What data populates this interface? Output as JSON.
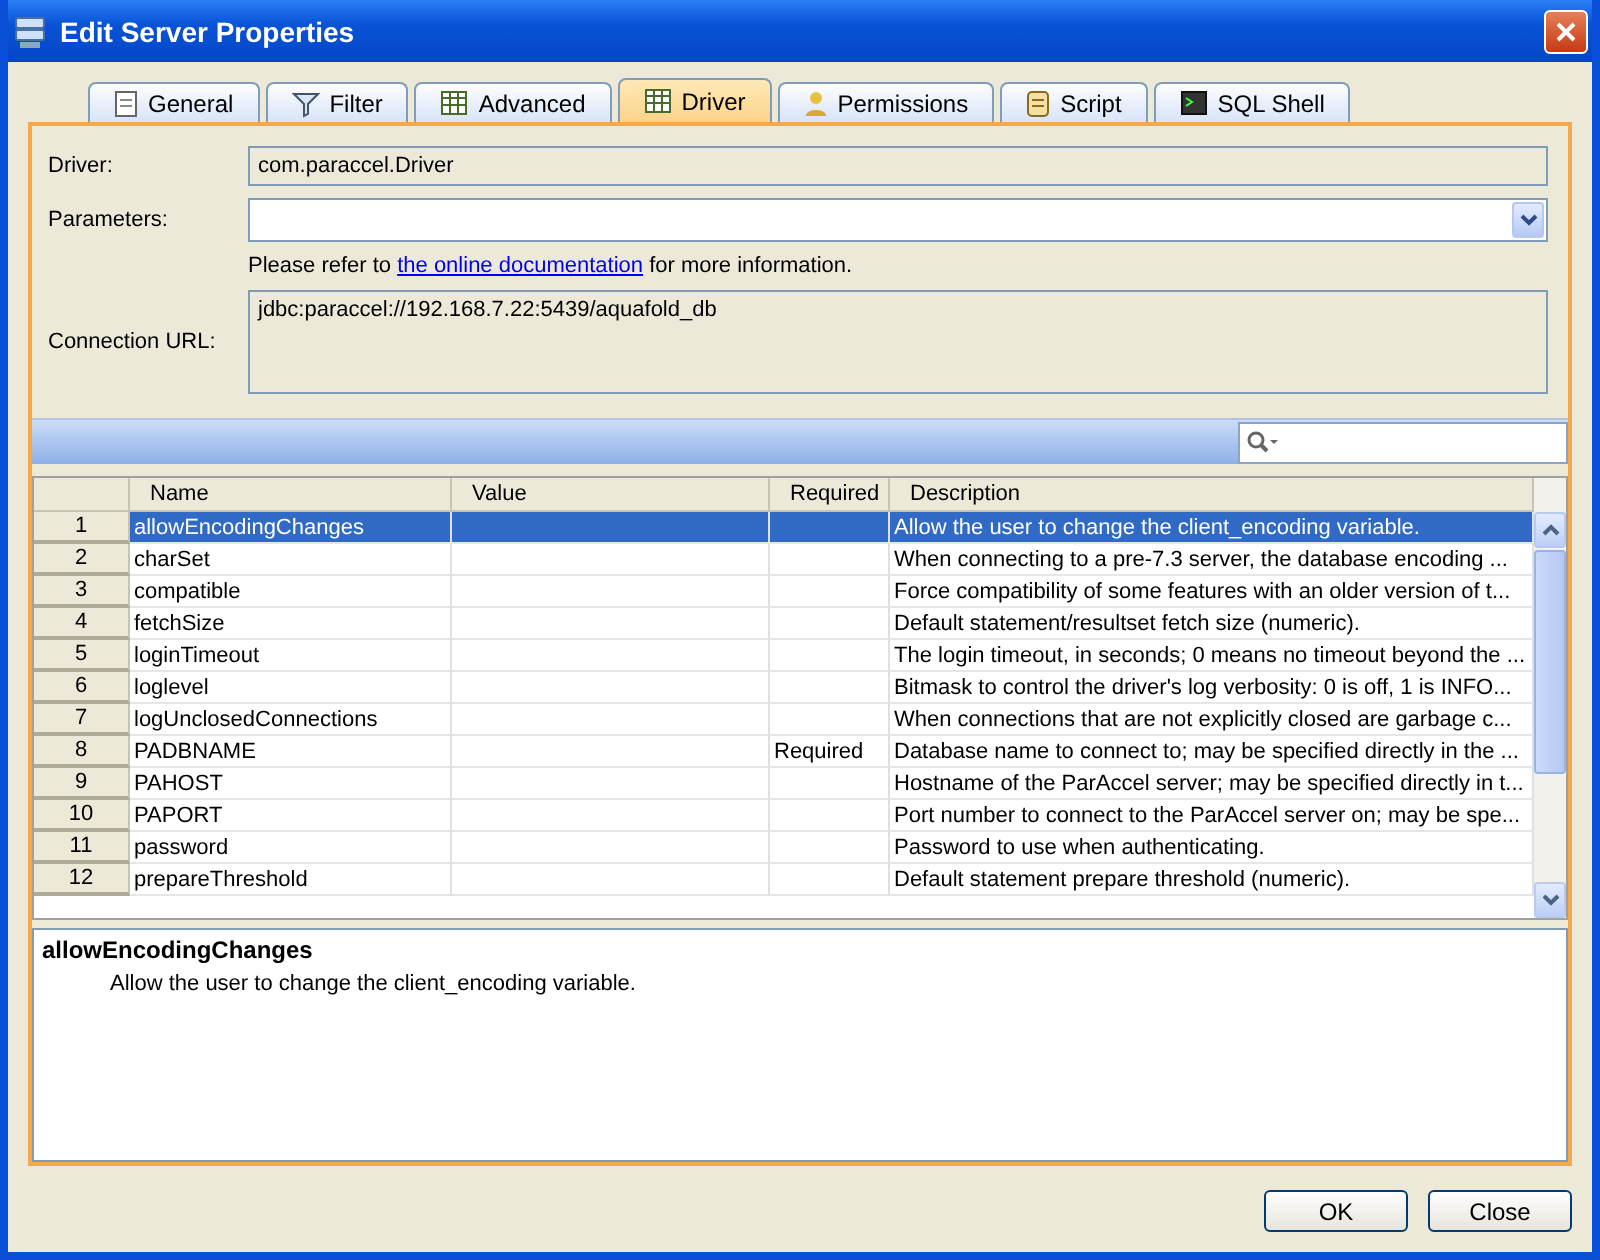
{
  "window": {
    "title": "Edit Server Properties"
  },
  "tabs": [
    {
      "label": "General",
      "selected": false,
      "kind": "doc"
    },
    {
      "label": "Filter",
      "selected": false,
      "kind": "filter"
    },
    {
      "label": "Advanced",
      "selected": false,
      "kind": "grid"
    },
    {
      "label": "Driver",
      "selected": true,
      "kind": "grid"
    },
    {
      "label": "Permissions",
      "selected": false,
      "kind": "user"
    },
    {
      "label": "Script",
      "selected": false,
      "kind": "script"
    },
    {
      "label": "SQL Shell",
      "selected": false,
      "kind": "shell"
    }
  ],
  "form": {
    "driver_label": "Driver:",
    "driver": "com.paraccel.Driver",
    "parameters_label": "Parameters:",
    "note_before": "Please refer to ",
    "note_link": "the online documentation",
    "note_after": " for more information.",
    "url_label": "Connection URL:",
    "url": "jdbc:paraccel://192.168.7.22:5439/aquafold_db"
  },
  "table": {
    "columns": [
      "Name",
      "Value",
      "Required",
      "Description"
    ],
    "rows": [
      {
        "index": "1",
        "name": "allowEncodingChanges",
        "value": "",
        "required": "",
        "description": "Allow the user to change the client_encoding variable.",
        "selected": true
      },
      {
        "index": "2",
        "name": "charSet",
        "value": "",
        "required": "",
        "description": "When connecting to a pre-7.3 server, the database encoding ...",
        "selected": false
      },
      {
        "index": "3",
        "name": "compatible",
        "value": "",
        "required": "",
        "description": "Force compatibility of some features with an older version of t...",
        "selected": false
      },
      {
        "index": "4",
        "name": "fetchSize",
        "value": "",
        "required": "",
        "description": "Default statement/resultset fetch size (numeric).",
        "selected": false
      },
      {
        "index": "5",
        "name": "loginTimeout",
        "value": "",
        "required": "",
        "description": "The login timeout, in seconds; 0 means no timeout beyond the ...",
        "selected": false
      },
      {
        "index": "6",
        "name": "loglevel",
        "value": "",
        "required": "",
        "description": "Bitmask to control the driver's log verbosity: 0 is off, 1 is INFO...",
        "selected": false
      },
      {
        "index": "7",
        "name": "logUnclosedConnections",
        "value": "",
        "required": "",
        "description": "When connections that are not explicitly closed are garbage c...",
        "selected": false
      },
      {
        "index": "8",
        "name": "PADBNAME",
        "value": "",
        "required": "Required",
        "description": "Database name to connect to; may be specified directly in the ...",
        "selected": false
      },
      {
        "index": "9",
        "name": "PAHOST",
        "value": "",
        "required": "",
        "description": "Hostname of the ParAccel server; may be specified directly in t...",
        "selected": false
      },
      {
        "index": "10",
        "name": "PAPORT",
        "value": "",
        "required": "",
        "description": "Port number to connect to the ParAccel server on; may be spe...",
        "selected": false
      },
      {
        "index": "11",
        "name": "password",
        "value": "",
        "required": "",
        "description": "Password to use when authenticating.",
        "selected": false
      },
      {
        "index": "12",
        "name": "prepareThreshold",
        "value": "",
        "required": "",
        "description": "Default statement prepare threshold (numeric).",
        "selected": false
      }
    ]
  },
  "detail": {
    "title": "allowEncodingChanges",
    "text": "Allow the user to change the client_encoding variable."
  },
  "buttons": [
    "OK",
    "Close"
  ]
}
